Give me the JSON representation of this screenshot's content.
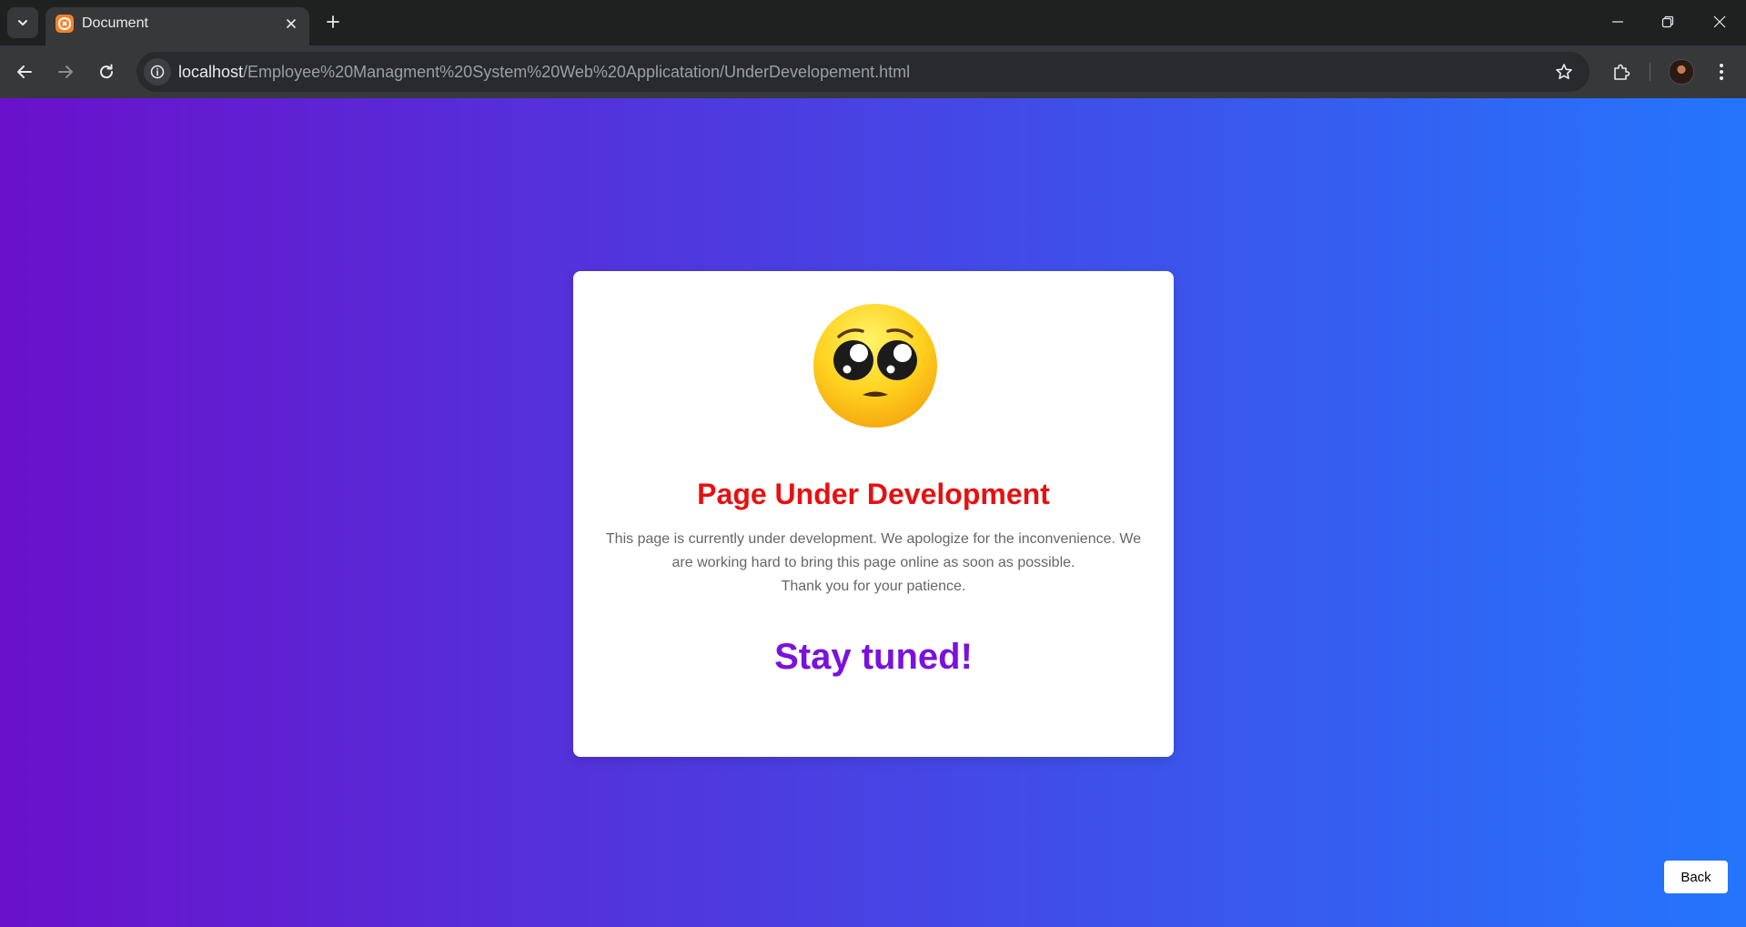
{
  "browser": {
    "tab_title": "Document",
    "url_host": "localhost",
    "url_path": "/Employee%20Managment%20System%20Web%20Applicatation/UnderDevelopement.html"
  },
  "page": {
    "heading": "Page Under Development",
    "message_line1": "This page is currently under development. We apologize for the inconvenience. We are working hard to bring this page online as soon as possible.",
    "message_line2": "Thank you for your patience.",
    "tagline": "Stay tuned!",
    "back_label": "Back"
  },
  "icons": {
    "emoji": "pleading-face-icon"
  },
  "colors": {
    "gradient_start": "#6a11cb",
    "gradient_end": "#2575fc",
    "heading": "#e81010",
    "tagline": "#7a12dc",
    "message": "#666666"
  }
}
